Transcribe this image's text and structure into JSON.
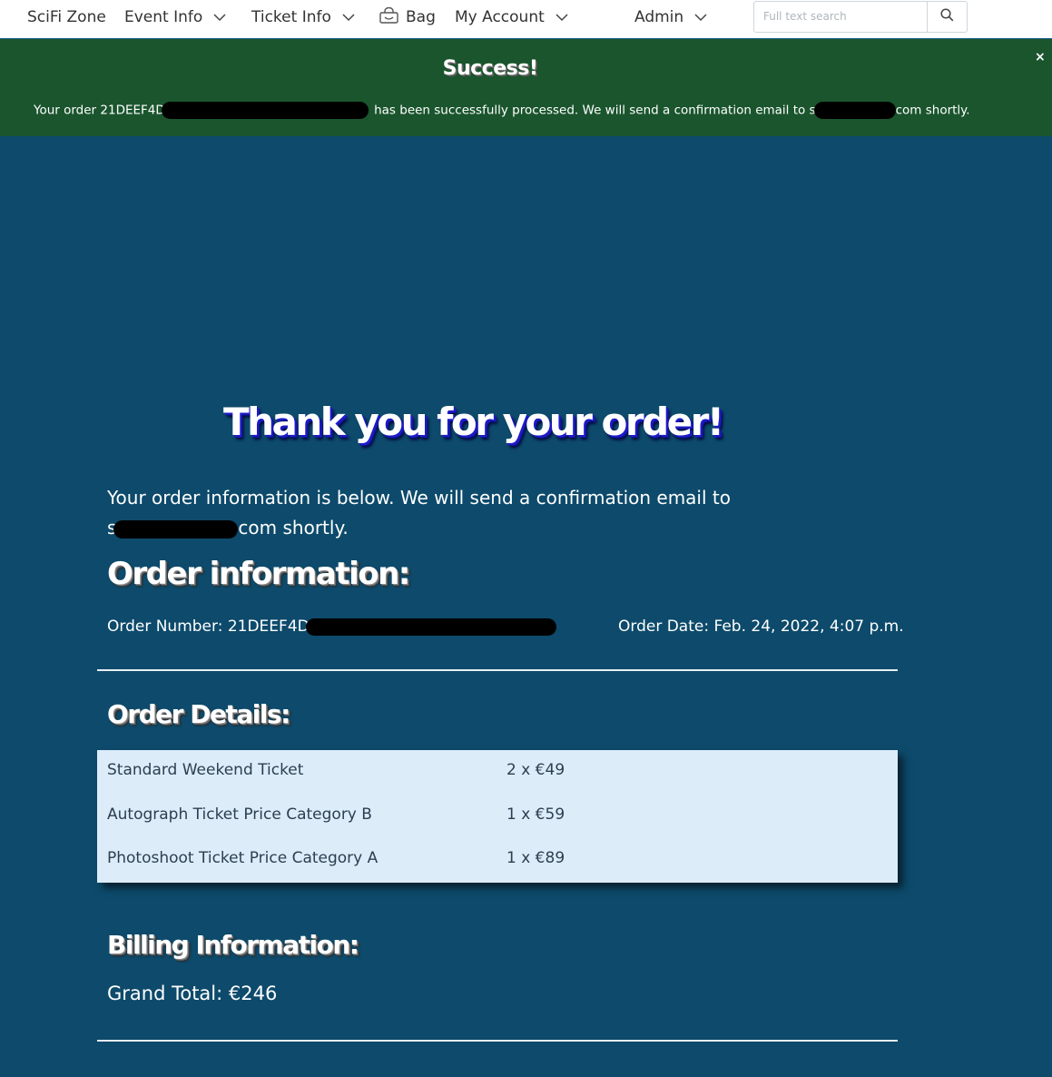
{
  "nav": {
    "brand": "SciFi Zone",
    "event_info": "Event Info",
    "ticket_info": "Ticket Info",
    "bag": "Bag",
    "my_account": "My Account",
    "admin": "Admin",
    "search_placeholder": "Full text search",
    "search_icon": "search-icon",
    "bag_icon": "shopping-bag-icon"
  },
  "alert": {
    "title": "Success!",
    "close": "×",
    "message_start": "Your order 21DEEF4D",
    "message_mid": "has been successfully processed. We will send a confirmation email to s",
    "message_end": "com shortly.",
    "color": "#1a552d"
  },
  "main": {
    "heading": "Thank you for your order!",
    "intro_line1": "Your order information is below. We will send a confirmation email to",
    "intro_line2_start": "s",
    "intro_line2_end": "com shortly.",
    "order_info_heading": "Order information:",
    "order_number_label": "Order Number: 21DEEF4D",
    "order_date": "Order Date: Feb. 24, 2022, 4:07 p.m.",
    "order_details_heading": "Order Details:",
    "items": [
      {
        "name": "Standard Weekend Ticket",
        "qty": "2 x €49"
      },
      {
        "name": "Autograph Ticket Price Category B",
        "qty": "1 x €59"
      },
      {
        "name": "Photoshoot Ticket Price Category A",
        "qty": "1 x €89"
      }
    ],
    "billing_heading": "Billing Information:",
    "grand_total": "Grand Total: €246",
    "background_color": "#0d4a6b"
  }
}
